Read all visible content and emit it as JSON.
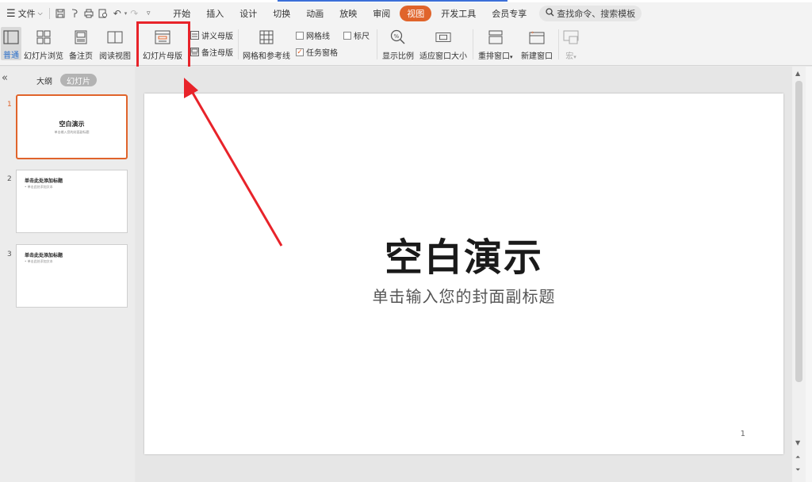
{
  "menubar": {
    "menu_icon": "hamburger-icon",
    "file_label": "文件",
    "tabs": [
      "开始",
      "插入",
      "设计",
      "切换",
      "动画",
      "放映",
      "审阅",
      "视图",
      "开发工具",
      "会员专享"
    ],
    "active_tab": "视图",
    "search_placeholder": "查找命令、搜索模板"
  },
  "ribbon": {
    "normal": "普通",
    "slide_sorter": "幻灯片浏览",
    "notes_page": "备注页",
    "reading_view": "阅读视图",
    "slide_master": "幻灯片母版",
    "handout_master": "讲义母版",
    "notes_master": "备注母版",
    "grid_guides": "网格和参考线",
    "gridlines": "网格线",
    "ruler": "标尺",
    "task_pane": "任务窗格",
    "zoom": "显示比例",
    "fit_window": "适应窗口大小",
    "arrange": "重排窗口",
    "new_window": "新建窗口",
    "macro": "宏"
  },
  "leftpanel": {
    "outline_tab": "大纲",
    "slides_tab": "幻灯片",
    "thumbs": [
      {
        "num": "1",
        "title": "空白演示",
        "sub": "单击输入您的封面副标题"
      },
      {
        "num": "2",
        "title": "单击此处添加标题",
        "sub": "• 单击此处添加文本"
      },
      {
        "num": "3",
        "title": "单击此处添加标题",
        "sub": "• 单击此处添加文本"
      }
    ]
  },
  "slide": {
    "title": "空白演示",
    "subtitle": "单击输入您的封面副标题",
    "page_number": "1"
  },
  "annotation_color": "#e8232a",
  "accent_color": "#e0642b"
}
